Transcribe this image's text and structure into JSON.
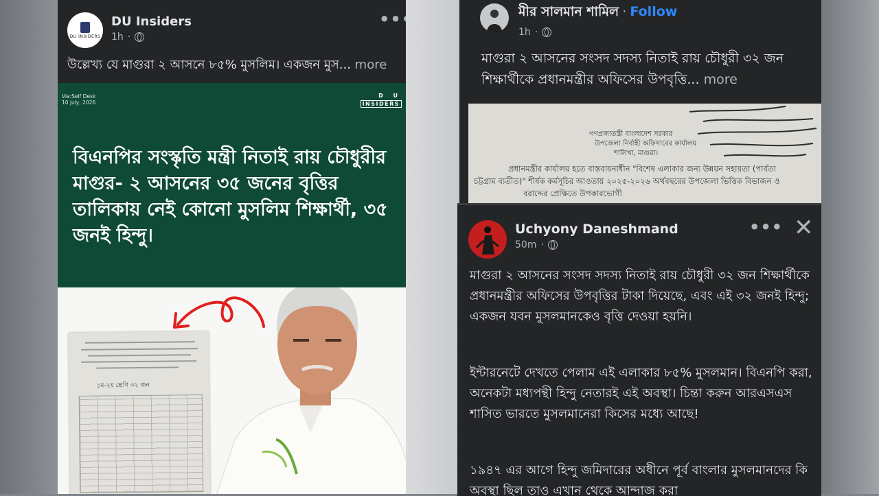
{
  "post1": {
    "author": "DU Insiders",
    "time": "1h",
    "avatar_text": "DU INSIDERS",
    "caption": "উল্লেখ্য যে মাগুরা ২ আসনে ৮৫% মুসলিম। একজন মুস...",
    "more": "more",
    "banner": {
      "via": "Via:Self Desk",
      "date": "10 july, 2026",
      "brand_top": "D U",
      "brand_bottom": "INSIDERS",
      "headline": "বিএনপির সংস্কৃতি মন্ত্রী নিতাই রায় চৌধুরীর মাগুর- ২ আসনের ৩৫ জনের বৃত্তির তালিকায় নেই কোনো মুসলিম শিক্ষার্থী, ৩৫ জনই হিন্দু।"
    },
    "doc_caption": "১ম-২য় শ্রেণি    ৩২ জন"
  },
  "post2": {
    "author": "মীর সালমান শামিল",
    "follow": "Follow",
    "separator": "·",
    "time": "1h",
    "caption": "মাগুরা ২ আসনের সংসদ সদস্য নিতাই রায় চৌধুরী ৩২ জন শিক্ষার্থীকে প্রধানমন্ত্রীর অফিসের উপবৃত্তি...",
    "more": "more",
    "image_lines": [
      "গণপ্রজাতন্ত্রী বাংলাদেশ সরকার",
      "উপজেলা নির্বাহী অফিসারের কার্যালয়",
      "শালিখা, মাগুরা।",
      "প্রধানমন্ত্রীর কার্যালয় হতে বাস্তবায়নাধীন \"বিশেষ এলাকার জন্য উন্নয়ন সহায়তা (পার্বত্য",
      "চট্টগ্রাম ব্যতীত)\" শীর্ষক কর্মসূচির আওতায় ২০২৫-২০২৬ অর্থবছরের উপজেলা ভিত্তিক বিভাজন ও",
      "বরাদ্দের প্রেক্ষিতে উপকারভোগী"
    ]
  },
  "post3": {
    "author": "Uchyony Daneshmand",
    "time": "50m",
    "paragraphs": [
      "মাগুরা ২ আসনের সংসদ সদস্য নিতাই রায় চৌধুরী ৩২ জন শিক্ষার্থীকে প্রধানমন্ত্রীর অফিসের উপবৃত্তির টাকা দিয়েছে, এবং এই ৩২ জনই হিন্দু; একজন যবন মুসলমানকেও বৃত্তি দেওয়া হয়নি।",
      "ইন্টারনেটে দেখতে পেলাম এই এলাকার ৮৫% মুসলমান। বিএনপি করা, অনেকটা মধ্যপন্থী হিন্দু নেতারই এই অবস্থা। চিন্তা করুন আরএসএস শাসিত ভারতে মুসলমানেরা কিসের মধ্যে আছে!",
      "১৯৪৭ এর আগে হিন্দু জমিদারের অধীনে পূর্ব বাংলার মুসলমানদের কি অবস্থা ছিল তাও এখান থেকে আন্দাজ করা"
    ]
  },
  "icons": {
    "more_options": "•••",
    "close": "✕"
  },
  "colors": {
    "card_bg": "#242526",
    "text_primary": "#e4e6eb",
    "text_secondary": "#b0b3b8",
    "follow_blue": "#2d88ff",
    "banner_green": "#0f4a36"
  }
}
